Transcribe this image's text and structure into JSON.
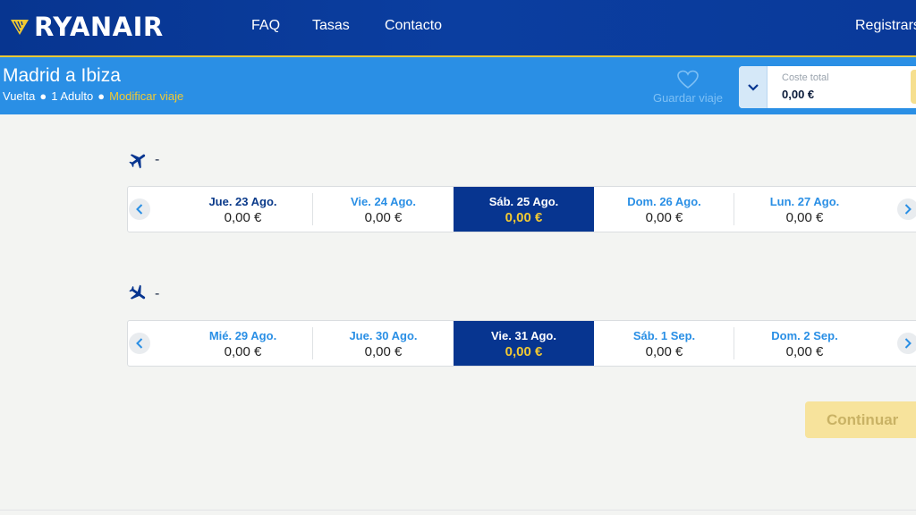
{
  "header": {
    "logo_text": "RYANAIR",
    "nav": {
      "faq": "FAQ",
      "tasas": "Tasas",
      "contacto": "Contacto"
    },
    "register": "Registrarse"
  },
  "trip": {
    "title": "Madrid a Ibiza",
    "type": "Vuelta",
    "passengers": "1 Adulto",
    "modify": "Modificar viaje",
    "save_label": "Guardar viaje",
    "cost_label": "Coste total",
    "cost_value": "0,00 €"
  },
  "outbound": {
    "route": "-",
    "dates": [
      {
        "label": "Jue. 23 Ago.",
        "price": "0,00 €"
      },
      {
        "label": "Vie. 24 Ago.",
        "price": "0,00 €"
      },
      {
        "label": "Sáb. 25 Ago.",
        "price": "0,00 €",
        "selected": true
      },
      {
        "label": "Dom. 26 Ago.",
        "price": "0,00 €"
      },
      {
        "label": "Lun. 27 Ago.",
        "price": "0,00 €"
      }
    ]
  },
  "return": {
    "route": "-",
    "dates": [
      {
        "label": "Mié. 29 Ago.",
        "price": "0,00 €"
      },
      {
        "label": "Jue. 30 Ago.",
        "price": "0,00 €"
      },
      {
        "label": "Vie. 31 Ago.",
        "price": "0,00 €",
        "selected": true
      },
      {
        "label": "Sáb. 1 Sep.",
        "price": "0,00 €"
      },
      {
        "label": "Dom. 2 Sep.",
        "price": "0,00 €"
      }
    ]
  },
  "actions": {
    "continue": "Continuar"
  },
  "icons": {
    "logo": "ryanair-harp-icon",
    "save": "heart-icon",
    "toggle": "chevron-down-icon",
    "outbound": "plane-departure-icon",
    "return": "plane-arrival-icon",
    "prev": "chevron-left-icon",
    "next": "chevron-right-icon"
  },
  "colors": {
    "header_blue": "#073590",
    "sub_blue": "#2a8fe5",
    "accent_yellow": "#f1c933",
    "selected_bg": "#073590"
  }
}
